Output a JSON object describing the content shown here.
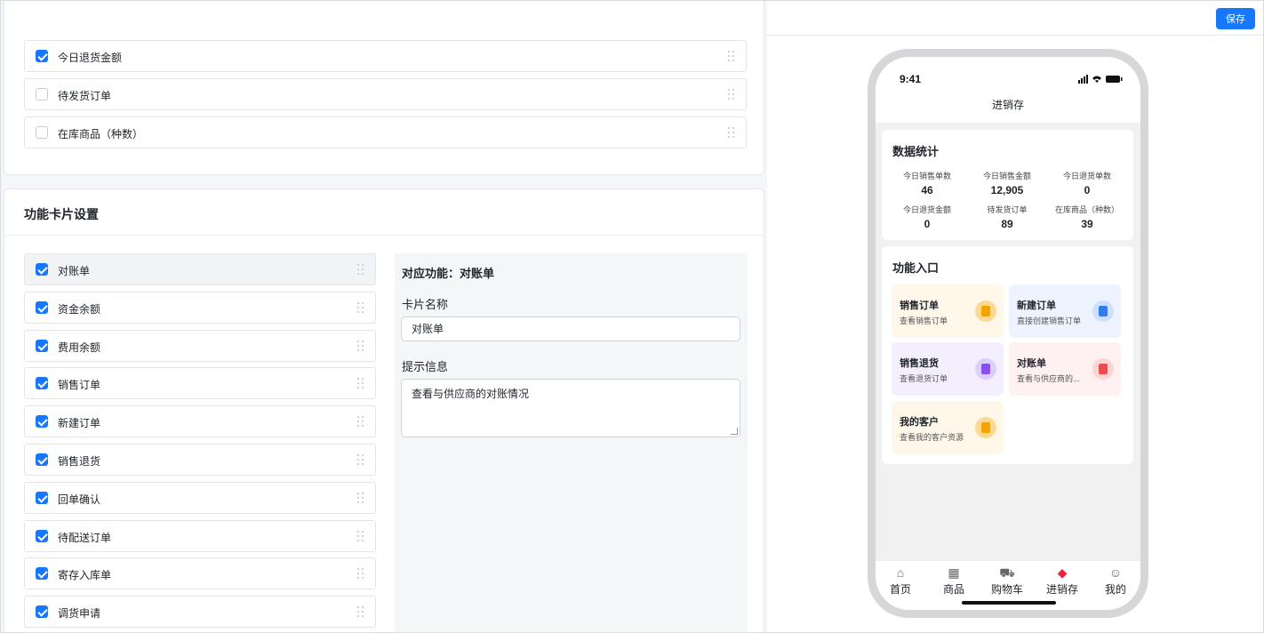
{
  "toolbar": {
    "save_label": "保存"
  },
  "stat_settings": {
    "items": [
      {
        "label": "今日退货金额",
        "checked": true
      },
      {
        "label": "待发货订单",
        "checked": false
      },
      {
        "label": "在库商品（种数）",
        "checked": false
      }
    ]
  },
  "function_cards": {
    "title": "功能卡片设置",
    "items": [
      {
        "label": "对账单",
        "checked": true,
        "active": true
      },
      {
        "label": "资金余额",
        "checked": true
      },
      {
        "label": "费用余额",
        "checked": true
      },
      {
        "label": "销售订单",
        "checked": true
      },
      {
        "label": "新建订单",
        "checked": true
      },
      {
        "label": "销售退货",
        "checked": true
      },
      {
        "label": "回单确认",
        "checked": true
      },
      {
        "label": "待配送订单",
        "checked": true
      },
      {
        "label": "寄存入库单",
        "checked": true
      },
      {
        "label": "调货申请",
        "checked": true
      }
    ]
  },
  "editor": {
    "function_label": "对应功能：对账单",
    "name_label": "卡片名称",
    "name_value": "对账单",
    "tip_label": "提示信息",
    "tip_value": "查看与供应商的对账情况"
  },
  "phone": {
    "time": "9:41",
    "title": "进销存",
    "stats_title": "数据统计",
    "stats": [
      {
        "label": "今日销售单数",
        "value": "46"
      },
      {
        "label": "今日销售金额",
        "value": "12,905"
      },
      {
        "label": "今日退货单数",
        "value": "0"
      },
      {
        "label": "今日退货金额",
        "value": "0"
      },
      {
        "label": "待发货订单",
        "value": "89"
      },
      {
        "label": "在库商品（种数）",
        "value": "39"
      }
    ],
    "entries_title": "功能入口",
    "entries": [
      {
        "title": "销售订单",
        "sub": "查看销售订单",
        "icon": "clipboard-icon",
        "bg": "#fff7ea",
        "icon_bg": "#ffd992",
        "icon_fg": "#f5a300"
      },
      {
        "title": "新建订单",
        "sub": "直接创建销售订单",
        "icon": "document-plus-icon",
        "bg": "#eef4ff",
        "icon_bg": "#cfe0ff",
        "icon_fg": "#2f7bf0"
      },
      {
        "title": "销售退货",
        "sub": "查看退货订单",
        "icon": "return-doc-icon",
        "bg": "#f3efff",
        "icon_bg": "#dccfff",
        "icon_fg": "#8a4df2"
      },
      {
        "title": "对账单",
        "sub": "查看与供应商的...",
        "icon": "statement-icon",
        "bg": "#fff1f1",
        "icon_bg": "#ffd3d3",
        "icon_fg": "#f04a4a"
      },
      {
        "title": "我的客户",
        "sub": "查看我的客户资源",
        "icon": "customer-card-icon",
        "bg": "#fff7ea",
        "icon_bg": "#ffd992",
        "icon_fg": "#f5a300"
      }
    ],
    "tabs": [
      {
        "label": "首页",
        "icon": "home-icon"
      },
      {
        "label": "商品",
        "icon": "grid-icon"
      },
      {
        "label": "购物车",
        "icon": "cart-icon"
      },
      {
        "label": "进销存",
        "icon": "tag-icon",
        "active": true
      },
      {
        "label": "我的",
        "icon": "user-icon"
      }
    ]
  },
  "colors": {
    "accent": "#1677ff",
    "active_tab": "#f0243c"
  }
}
